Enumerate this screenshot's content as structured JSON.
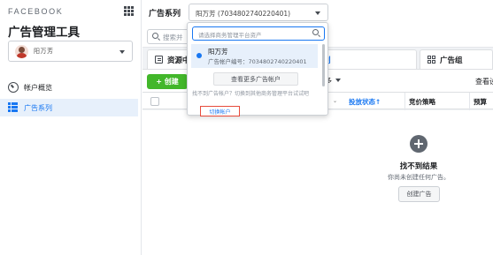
{
  "sidebar": {
    "brand": "FACEBOOK",
    "app_title": "广告管理工具",
    "account_name": "阳万芳",
    "nav": [
      {
        "label": "帐户概览",
        "icon": "overview-icon",
        "active": false
      },
      {
        "label": "广告系列",
        "icon": "table-icon",
        "active": true
      }
    ]
  },
  "topbar": {
    "series_label": "广告系列",
    "account_select_value": "阳万芳 (7034802740220401)"
  },
  "search": {
    "placeholder": "搜索并"
  },
  "tabs": [
    {
      "label": "资源中",
      "icon": "document-icon"
    },
    {
      "label": "列",
      "icon": ""
    },
    {
      "label": "广告组",
      "icon": "grid-icon"
    }
  ],
  "toolbar": {
    "create_label": "+ 创建",
    "more_label": "多",
    "view_label": "查看设"
  },
  "table": {
    "columns": [
      "投放状态↑",
      "竞价策略",
      "预算"
    ]
  },
  "empty_state": {
    "title": "找不到结果",
    "subtitle": "你尚未创建任何广告。",
    "button_label": "创建广告"
  },
  "dropdown": {
    "search_placeholder": "请选择商务管理平台资产",
    "options": [
      {
        "name": "阳万芳",
        "account_id": "广告帐户编号：7034802740220401"
      }
    ],
    "more_label": "查看更多广告帐户",
    "hint": "找不到广告帐户？切换到其他商务管理平台试试吧",
    "switch_label": "切换帐户"
  },
  "colors": {
    "accent": "#1877f2",
    "create_green": "#42b72a",
    "highlight_border": "#e74c3c"
  }
}
